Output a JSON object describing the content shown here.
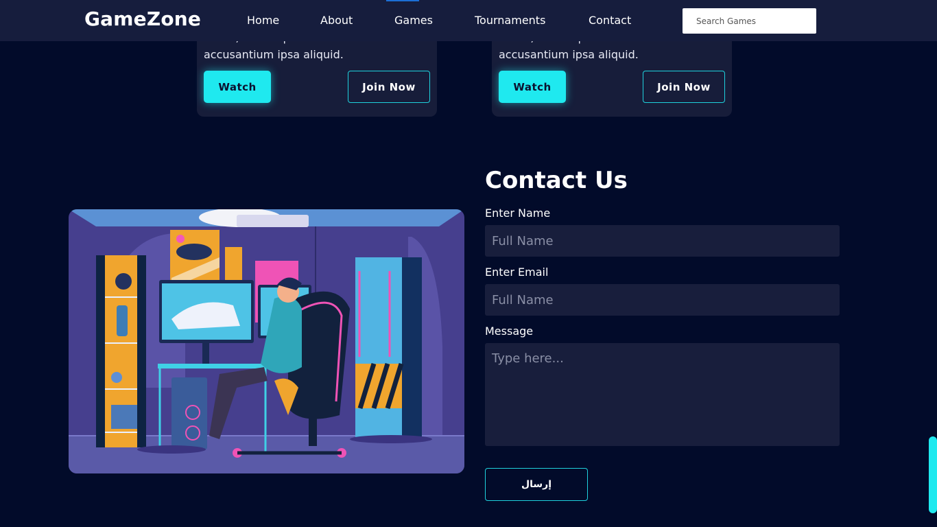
{
  "nav": {
    "logo": "GameZone",
    "links": [
      "Home",
      "About",
      "Games",
      "Tournaments",
      "Contact"
    ],
    "search_placeholder": "Search Games"
  },
  "cards": [
    {
      "text_line1": "Natus, quibusdam distinctio",
      "text_line2": "accusantium ipsa aliquid.",
      "watch_label": "Watch",
      "join_label": "Join Now"
    },
    {
      "text_line1": "Natus, quibusdam distinctio",
      "text_line2": "accusantium ipsa aliquid.",
      "watch_label": "Watch",
      "join_label": "Join Now"
    }
  ],
  "contact": {
    "title": "Contact Us",
    "name_label": "Enter Name",
    "name_placeholder": "Full Name",
    "email_label": "Enter Email",
    "email_placeholder": "Full Name",
    "message_label": "Message",
    "message_placeholder": "Type here...",
    "submit_label": "إرسال"
  },
  "colors": {
    "accent": "#1fe9ef",
    "background": "#020b2a",
    "navbar": "#161d3d",
    "card": "#171d3a",
    "input": "#181e3c"
  }
}
